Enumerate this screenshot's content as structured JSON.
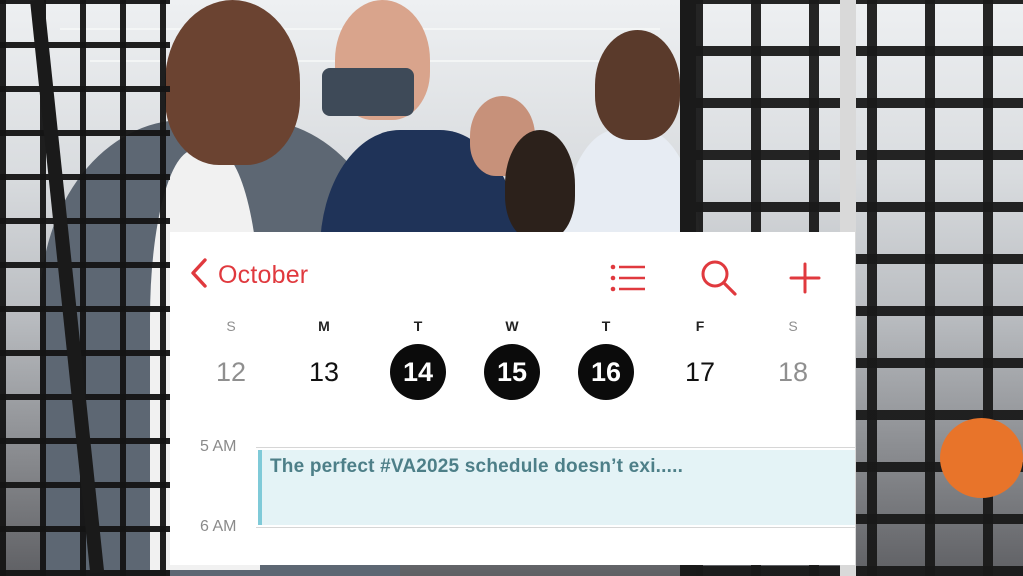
{
  "calendar": {
    "month_label": "October",
    "accent_color": "#e0393e",
    "icons": [
      "chevron-left-icon",
      "list-icon",
      "search-icon",
      "plus-icon"
    ],
    "week": [
      {
        "dow": "S",
        "date": "12",
        "state": "weekend"
      },
      {
        "dow": "M",
        "date": "13",
        "state": "normal"
      },
      {
        "dow": "T",
        "date": "14",
        "state": "selected"
      },
      {
        "dow": "W",
        "date": "15",
        "state": "selected"
      },
      {
        "dow": "T",
        "date": "16",
        "state": "selected"
      },
      {
        "dow": "F",
        "date": "17",
        "state": "normal"
      },
      {
        "dow": "S",
        "date": "18",
        "state": "weekend"
      }
    ],
    "times": [
      "5 AM",
      "6 AM"
    ],
    "event": {
      "title": "The perfect #VA2025 schedule doesn’t exi.....",
      "color": "#7fcad8"
    }
  }
}
